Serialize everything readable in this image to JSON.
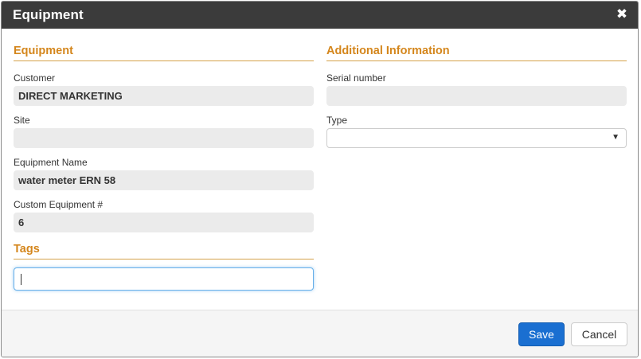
{
  "dialog": {
    "title": "Equipment",
    "close_glyph": "✖"
  },
  "left": {
    "section_title": "Equipment",
    "customer_label": "Customer",
    "customer_value": "DIRECT MARKETING",
    "site_label": "Site",
    "site_value": "",
    "equipment_name_label": "Equipment Name",
    "equipment_name_value": "water meter ERN 58",
    "custom_equipment_label": "Custom Equipment #",
    "custom_equipment_value": "6",
    "tags_title": "Tags",
    "tags_value": ""
  },
  "right": {
    "section_title": "Additional Information",
    "serial_label": "Serial number",
    "serial_value": "",
    "type_label": "Type",
    "type_value": "",
    "type_arrow": "▼"
  },
  "footer": {
    "save_label": "Save",
    "cancel_label": "Cancel"
  },
  "colors": {
    "header_bg": "#3b3b3b",
    "section_title": "#d4861c",
    "primary_button": "#1a6fd1"
  }
}
